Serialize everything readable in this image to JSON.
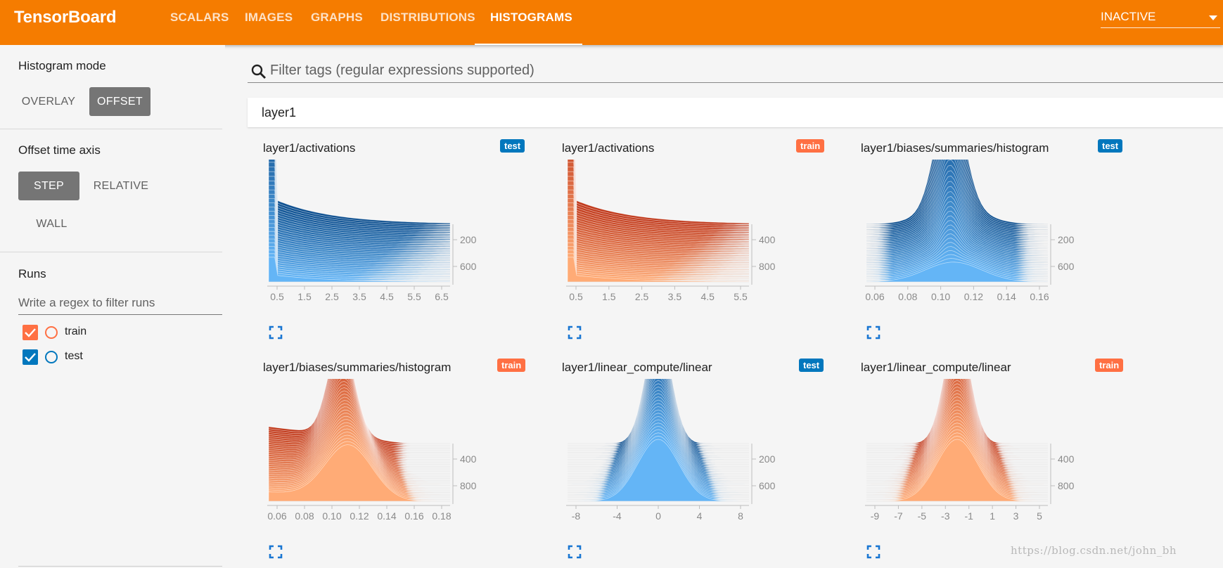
{
  "header": {
    "brand": "TensorBoard",
    "tabs": [
      {
        "label": "SCALARS",
        "active": false
      },
      {
        "label": "IMAGES",
        "active": false
      },
      {
        "label": "GRAPHS",
        "active": false
      },
      {
        "label": "DISTRIBUTIONS",
        "active": false
      },
      {
        "label": "HISTOGRAMS",
        "active": true
      }
    ],
    "dropdown_value": "INACTIVE"
  },
  "sidebar": {
    "histogram_mode": {
      "title": "Histogram mode",
      "options": [
        "OVERLAY",
        "OFFSET"
      ],
      "selected": "OFFSET"
    },
    "offset_axis": {
      "title": "Offset time axis",
      "options": [
        "STEP",
        "RELATIVE",
        "WALL"
      ],
      "selected": "STEP"
    },
    "runs": {
      "title": "Runs",
      "filter_placeholder": "Write a regex to filter runs",
      "items": [
        {
          "label": "train",
          "checked": true,
          "color": "#ff7043"
        },
        {
          "label": "test",
          "checked": true,
          "color": "#0277bd"
        }
      ]
    }
  },
  "main": {
    "filter_placeholder": "Filter tags (regular expressions supported)",
    "category": "layer1",
    "cards": [
      {
        "title": "layer1/activations",
        "run": "test",
        "palette": "blue",
        "shape": "activations",
        "xticks": [
          "0.5",
          "1.5",
          "2.5",
          "3.5",
          "4.5",
          "5.5",
          "6.5"
        ],
        "yticks": [
          "200",
          "600"
        ]
      },
      {
        "title": "layer1/activations",
        "run": "train",
        "palette": "orange",
        "shape": "activations",
        "xticks": [
          "0.5",
          "1.5",
          "2.5",
          "3.5",
          "4.5",
          "5.5"
        ],
        "yticks": [
          "400",
          "800"
        ]
      },
      {
        "title": "layer1/biases/summaries/histogram",
        "run": "test",
        "palette": "blue",
        "shape": "spike",
        "xticks": [
          "0.06",
          "0.08",
          "0.10",
          "0.12",
          "0.14",
          "0.16"
        ],
        "yticks": [
          "200",
          "600"
        ]
      },
      {
        "title": "layer1/biases/summaries/histogram",
        "run": "train",
        "palette": "orange",
        "shape": "lump",
        "xticks": [
          "0.06",
          "0.08",
          "0.10",
          "0.12",
          "0.14",
          "0.16",
          "0.18"
        ],
        "yticks": [
          "400",
          "800"
        ]
      },
      {
        "title": "layer1/linear_compute/linear",
        "run": "test",
        "palette": "blue",
        "shape": "bell",
        "xticks": [
          "-8",
          "-4",
          "0",
          "4",
          "8"
        ],
        "yticks": [
          "200",
          "600"
        ]
      },
      {
        "title": "layer1/linear_compute/linear",
        "run": "train",
        "palette": "orange",
        "shape": "bell",
        "xticks": [
          "-9",
          "-7",
          "-5",
          "-3",
          "-1",
          "1",
          "3",
          "5"
        ],
        "yticks": [
          "400",
          "800"
        ]
      }
    ]
  },
  "colors": {
    "accent": "#f57c00",
    "blue_dark": "#0d4f8f",
    "blue_light": "#64b5f6",
    "orange_dark": "#c0391b",
    "orange_light": "#ffab76"
  },
  "watermark": "https://blog.csdn.net/john_bh"
}
